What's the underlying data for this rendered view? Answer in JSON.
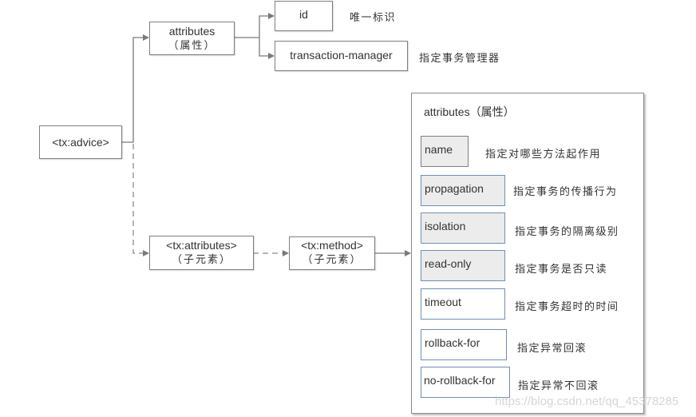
{
  "root": {
    "label": "<tx:advice>"
  },
  "attributes_node": {
    "label": "attributes",
    "sublabel": "（属性）"
  },
  "attribute_children": [
    {
      "label": "id",
      "description": "唯一标识"
    },
    {
      "label": "transaction-manager",
      "description": "指定事务管理器"
    }
  ],
  "tx_attributes_node": {
    "label": "<tx:attributes>",
    "sublabel": "（子元素）"
  },
  "tx_method_node": {
    "label": "<tx:method>",
    "sublabel": "（子元素）"
  },
  "method_attributes": {
    "title": "attributes（属性）",
    "items": [
      {
        "label": "name",
        "description": "指定对哪些方法起作用"
      },
      {
        "label": "propagation",
        "description": "指定事务的传播行为"
      },
      {
        "label": "isolation",
        "description": "指定事务的隔离级别"
      },
      {
        "label": "read-only",
        "description": "指定事务是否只读"
      },
      {
        "label": "timeout",
        "description": "指定事务超时的时间"
      },
      {
        "label": "rollback-for",
        "description": "指定异常回滚"
      },
      {
        "label": "no-rollback-for",
        "description": "指定异常不回滚"
      }
    ]
  },
  "watermark": "https://blog.csdn.net/qq_45378285",
  "colors": {
    "line": "#7a7a7a",
    "box_border": "#7f7f7f",
    "blue_border": "#6f8fb4",
    "gray_fill": "#ececec"
  }
}
